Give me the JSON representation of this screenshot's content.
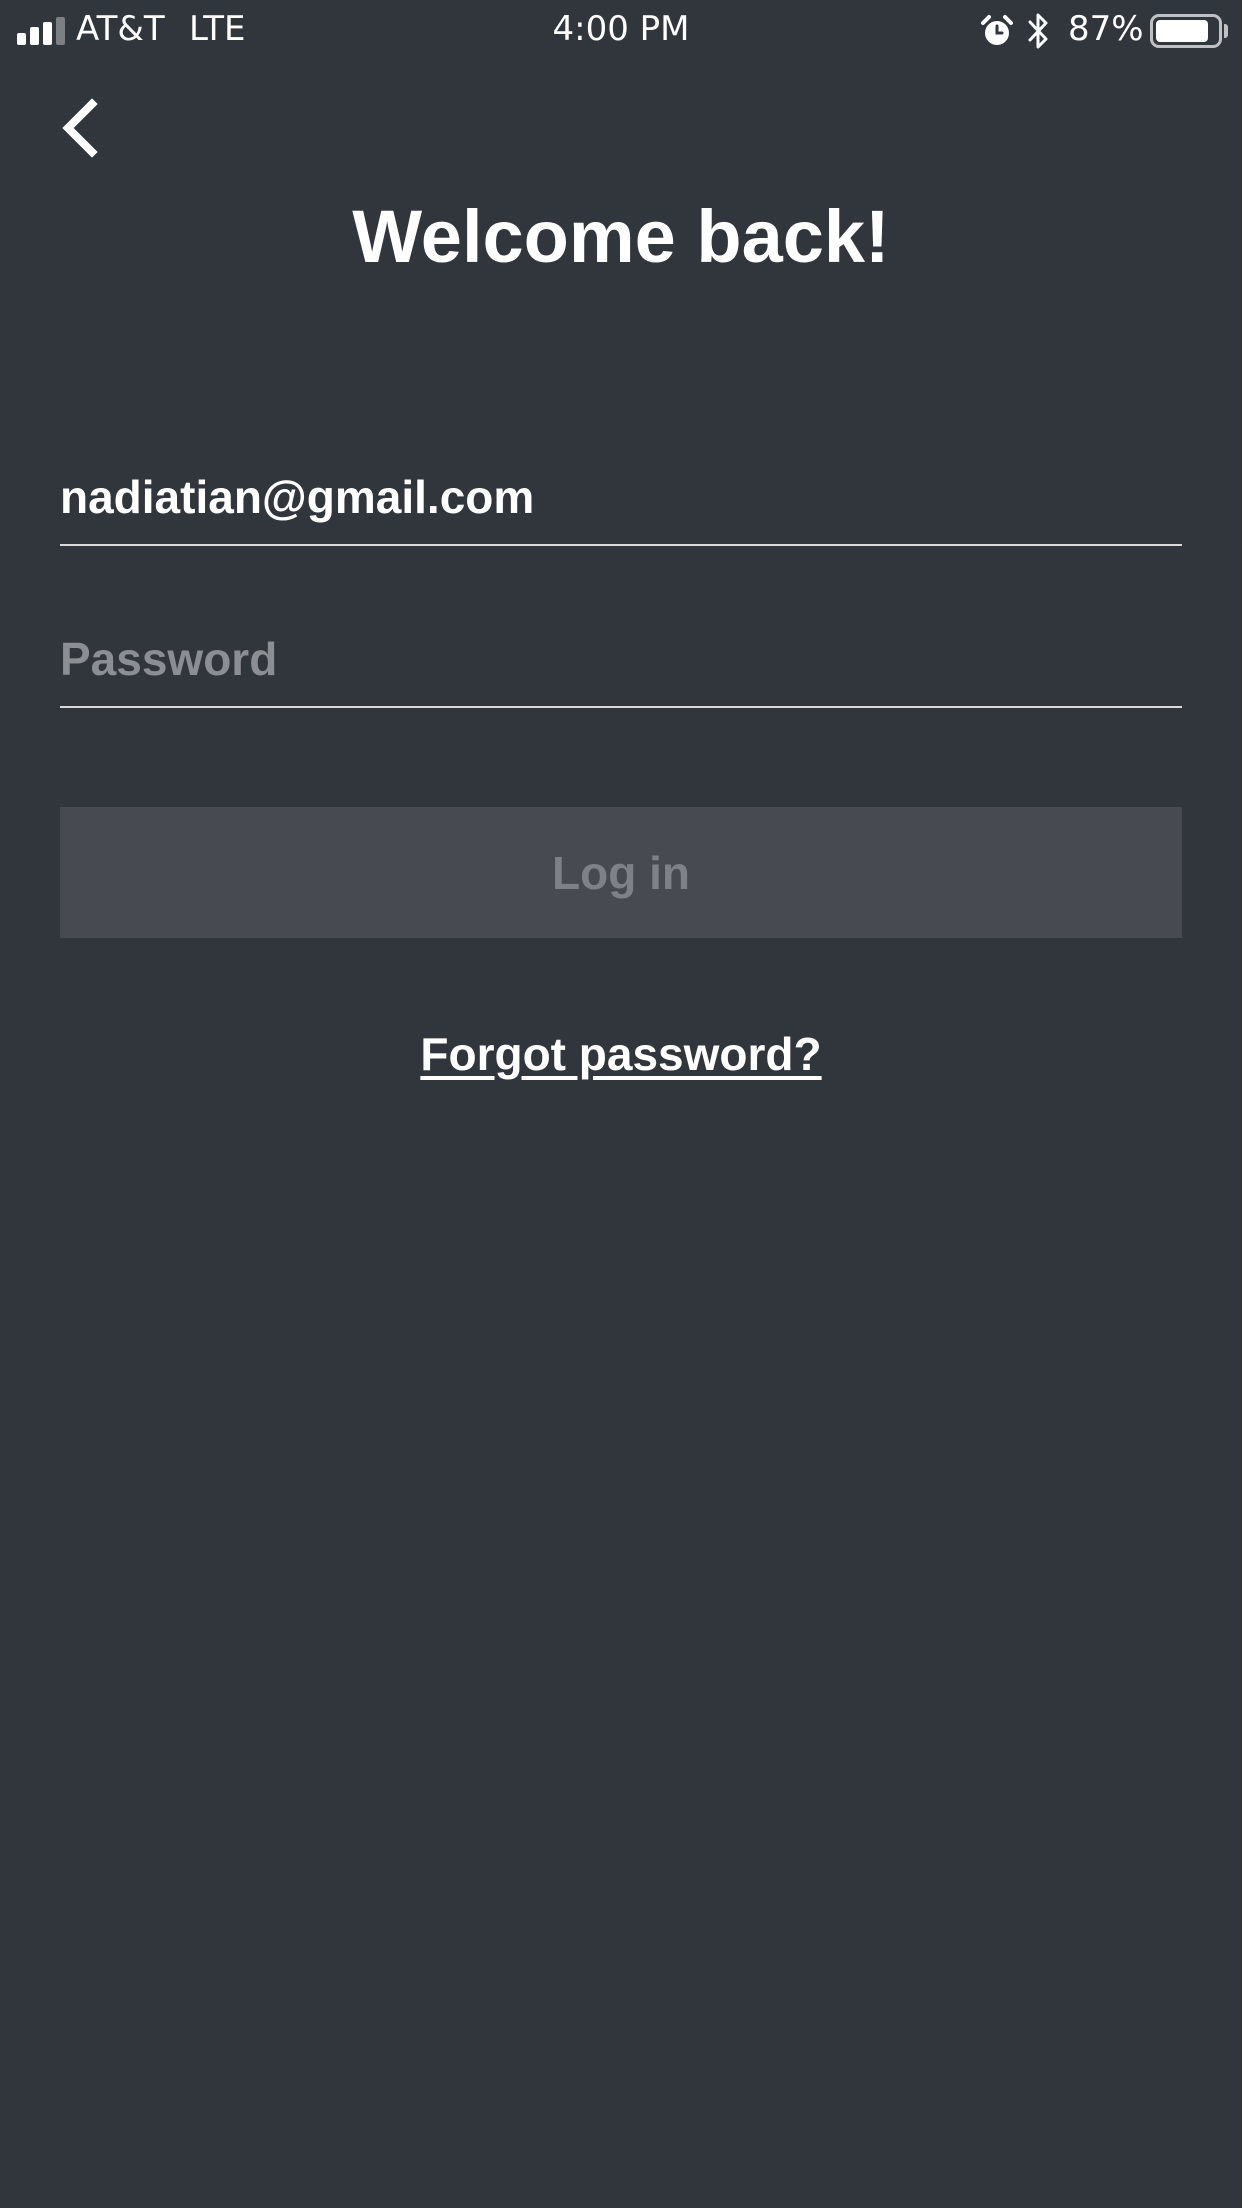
{
  "status_bar": {
    "carrier": "AT&T",
    "network": "LTE",
    "time": "4:00 PM",
    "battery_percent": "87%",
    "battery_level": 0.87,
    "signal_bars_active": 3,
    "signal_bars_total": 4,
    "icons": [
      "signal-icon",
      "alarm-icon",
      "bluetooth-icon",
      "battery-icon"
    ]
  },
  "header": {
    "back_icon": "chevron-left-icon",
    "title": "Welcome back!"
  },
  "form": {
    "email_value": "nadiatian@gmail.com",
    "password_placeholder": "Password",
    "password_value": "",
    "login_label": "Log in",
    "forgot_password_label": "Forgot password?"
  },
  "colors": {
    "background": "#31353c",
    "text": "#ffffff",
    "placeholder": "#8b8e93",
    "button_disabled_bg": "#474a51",
    "button_disabled_text": "#7e8186",
    "divider": "#d9dadc"
  }
}
